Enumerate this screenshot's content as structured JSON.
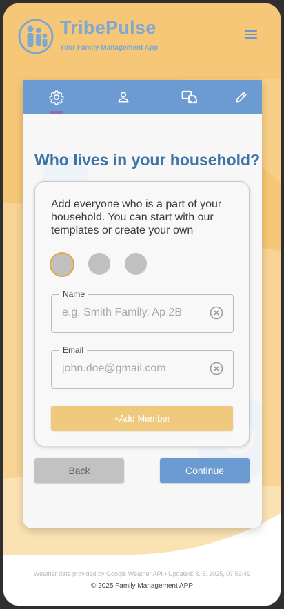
{
  "app": {
    "title": "TribePulse",
    "subtitle": "Your Family Management App",
    "menu_icon": "hamburger-icon"
  },
  "tabs": [
    {
      "icon": "gear-icon",
      "active": true
    },
    {
      "icon": "person-icon",
      "active": false
    },
    {
      "icon": "devices-icon",
      "active": false
    },
    {
      "icon": "pencil-icon",
      "active": false
    }
  ],
  "main": {
    "question": "Who lives in your household?",
    "description": "Add everyone who is a part of your household. You can start with our templates or create your own",
    "swatches": [
      {
        "color": "#c0c0c0",
        "selected": true
      },
      {
        "color": "#c0c0c0",
        "selected": false
      },
      {
        "color": "#c0c0c0",
        "selected": false
      }
    ],
    "name_field": {
      "label": "Name",
      "value": "",
      "placeholder": "e.g. Smith Family, Ap 2B"
    },
    "email_field": {
      "label": "Email",
      "value": "",
      "placeholder": "john.doe@gmail.com"
    },
    "add_member_label": "+Add Member",
    "back_label": "Back",
    "continue_label": "Continue"
  },
  "footer": {
    "weather": "Weather data provided by Google Weather API • Updated: 8. 5. 2025, 07:59:49",
    "copyright": "© 2025 Family Management APP"
  },
  "colors": {
    "primary": "#6b9bd1",
    "accent": "#efc97e",
    "background_orange": "#f5c777",
    "title_blue": "#3f74a8"
  }
}
